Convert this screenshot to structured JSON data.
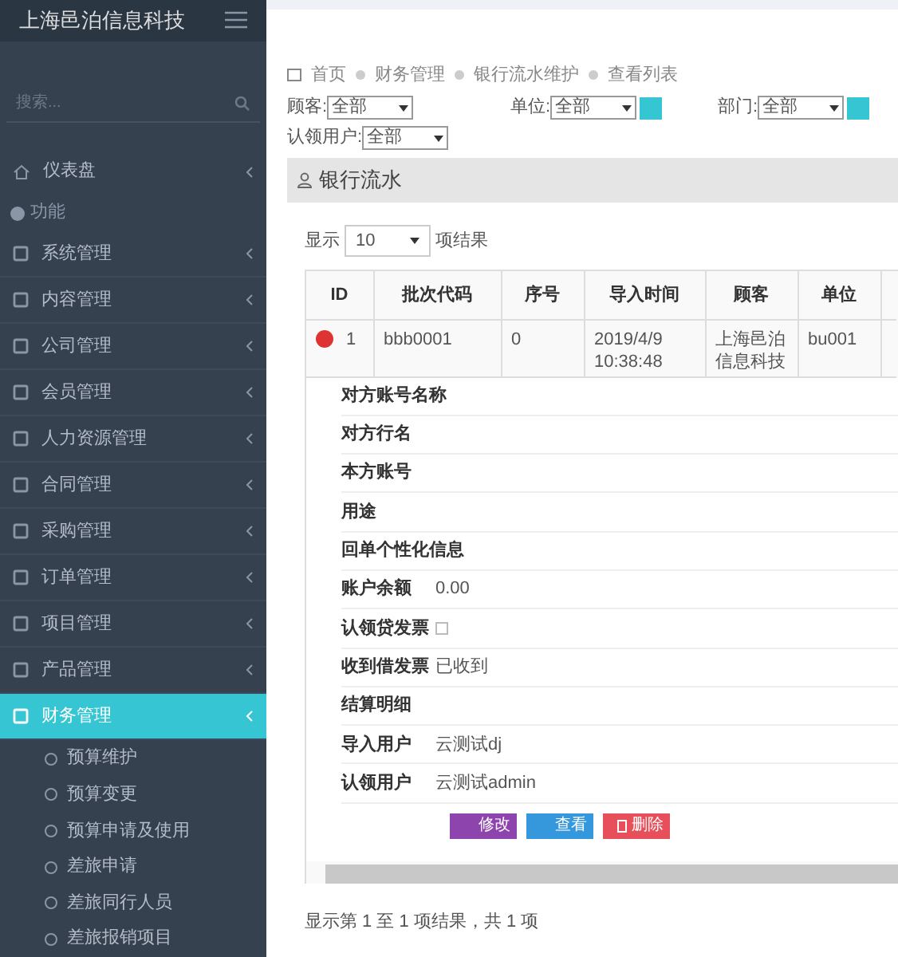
{
  "brand": "上海邑泊信息科技",
  "sidebar": {
    "search_placeholder": "搜索...",
    "dashboard": "仪表盘",
    "section_label": "功能",
    "items": [
      {
        "label": "系统管理",
        "selected": false
      },
      {
        "label": "内容管理",
        "selected": false
      },
      {
        "label": "公司管理",
        "selected": false
      },
      {
        "label": "会员管理",
        "selected": false
      },
      {
        "label": "人力资源管理",
        "selected": false
      },
      {
        "label": "合同管理",
        "selected": false
      },
      {
        "label": "采购管理",
        "selected": false
      },
      {
        "label": "订单管理",
        "selected": false
      },
      {
        "label": "项目管理",
        "selected": false
      },
      {
        "label": "产品管理",
        "selected": false
      },
      {
        "label": "财务管理",
        "selected": true
      }
    ],
    "sub_items": [
      "预算维护",
      "预算变更",
      "预算申请及使用",
      "差旅申请",
      "差旅同行人员",
      "差旅报销项目"
    ]
  },
  "breadcrumb": [
    "首页",
    "财务管理",
    "银行流水维护",
    "查看列表"
  ],
  "filters": [
    {
      "label": "顾客:",
      "value": "全部",
      "picker": false
    },
    {
      "label": "单位:",
      "value": "全部",
      "picker": true
    },
    {
      "label": "部门:",
      "value": "全部",
      "picker": true
    },
    {
      "label": "认领用户:",
      "value": "全部",
      "picker": false
    }
  ],
  "panel_title": "银行流水",
  "length": {
    "prefix": "显示",
    "value": "10",
    "suffix": "项结果"
  },
  "table": {
    "columns": [
      "ID",
      "批次代码",
      "序号",
      "导入时间",
      "顾客",
      "单位"
    ],
    "rows": [
      {
        "expanded": true,
        "cells": [
          "1",
          "bbb0001",
          "0",
          "2019/4/9 10:38:48",
          "上海邑泊信息科技",
          "bu001"
        ]
      }
    ]
  },
  "details": [
    {
      "label": "对方账号名称",
      "kind": "text"
    },
    {
      "label": "对方行名",
      "kind": "text"
    },
    {
      "label": "本方账号",
      "kind": "text"
    },
    {
      "label": "用途",
      "kind": "text"
    },
    {
      "label": "回单个性化信息",
      "kind": "text"
    },
    {
      "label": "账户余额",
      "kind": "text",
      "value": "0.00"
    },
    {
      "label": "认领贷发票",
      "kind": "checkbox",
      "checked": false
    },
    {
      "label": "收到借发票",
      "kind": "text",
      "value": "已收到"
    },
    {
      "label": "结算明细",
      "kind": "text"
    },
    {
      "label": "导入用户",
      "kind": "text",
      "value": "云测试dj"
    },
    {
      "label": "认领用户",
      "kind": "text",
      "value": "云测试admin"
    }
  ],
  "actions": [
    {
      "label": "修改",
      "kind": "edit"
    },
    {
      "label": "查看",
      "kind": "view"
    },
    {
      "label": "删除",
      "kind": "delete"
    }
  ],
  "footer": "显示第 1 至 1 项结果，共 1 项"
}
